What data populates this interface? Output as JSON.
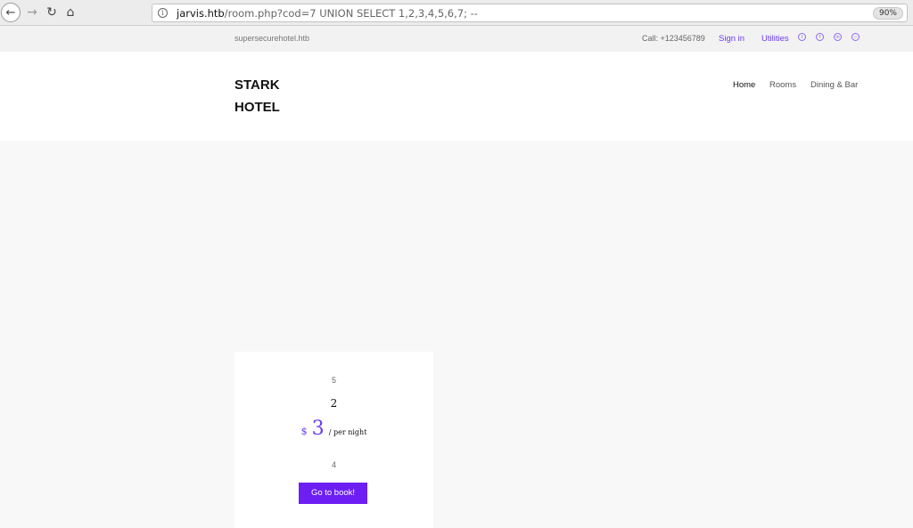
{
  "browser": {
    "url_host": "jarvis.htb",
    "url_path": "/room.php?cod=7 UNION SELECT 1,2,3,4,5,6,7; --",
    "zoom": "90%",
    "icons": {
      "back": "back-arrow-icon",
      "forward": "forward-arrow-icon",
      "reload": "reload-icon",
      "home": "home-icon",
      "info": "info-icon"
    }
  },
  "topbar": {
    "domain": "supersecurehotel.htb",
    "call": "Call: +123456789",
    "signin": "Sign in",
    "utilities": "Utilities",
    "social_icons": [
      "twitter-icon",
      "facebook-icon",
      "linkedin-icon",
      "instagram-icon"
    ]
  },
  "header": {
    "logo_line1": "STARK",
    "logo_line2": "HOTEL",
    "nav": {
      "home": "Home",
      "rooms": "Rooms",
      "dining": "Dining & Bar"
    }
  },
  "room": {
    "field5": "5",
    "field2": "2",
    "currency": "$",
    "price": "3",
    "price_unit": "/ per night",
    "field4": "4",
    "book_label": "Go to book!"
  },
  "colors": {
    "accent": "#6d1ff3",
    "link": "#6a3df0"
  }
}
